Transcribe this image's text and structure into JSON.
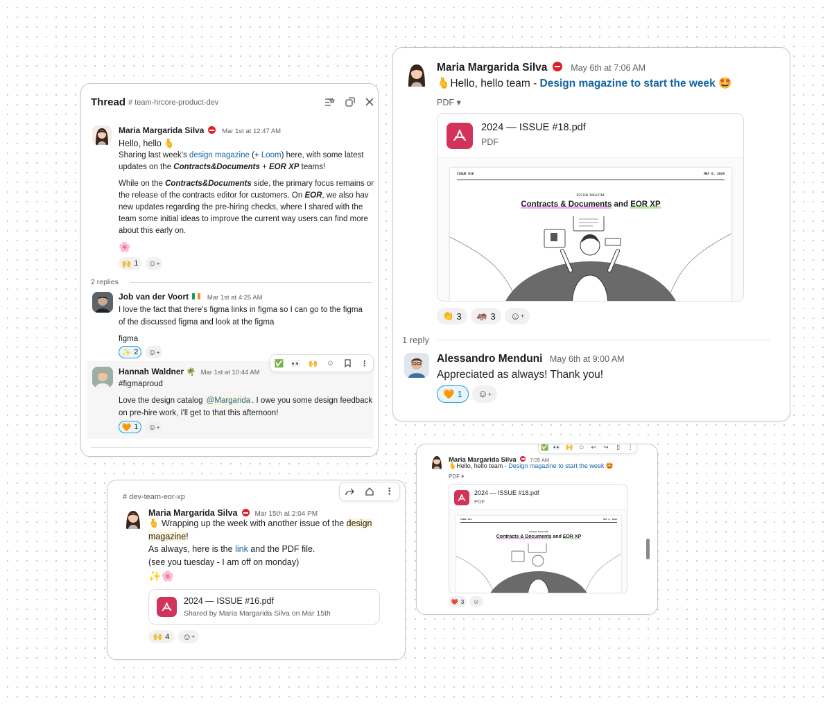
{
  "colors": {
    "link": "#1264a3",
    "pdf": "#d1335b",
    "mention_bg": "#fdf5d8",
    "reaction_active": "#1d9bd1"
  },
  "thread_panel": {
    "title": "Thread",
    "channel": "# team-hrcore-product-dev",
    "icons": [
      "list-settings-icon",
      "popout-icon",
      "close-icon"
    ],
    "parent": {
      "author": "Maria Margarida Silva",
      "status_icon": "no-entry-icon",
      "time": "Mar 1st at 12:47 AM",
      "line1": "Hello, hello",
      "line1_emoji": "🫰",
      "p1_a": "Sharing last week's ",
      "p1_link1": "design magazine",
      "p1_b": " (+ ",
      "p1_link2": "Loom",
      "p1_c": ") here, with some latest",
      "p1_d": "updates on the ",
      "p1_em1": "Contracts&Documents",
      "p1_e": " + ",
      "p1_em2": "EOR XP",
      "p1_f": " teams!",
      "p2_a": "While on the ",
      "p2_em1": "Contracts&Documents",
      "p2_b": " side, the primary focus remains on",
      "p2_c": "the release of the contracts editor for customers. On ",
      "p2_em2": "EOR",
      "p2_d": ", we also hav",
      "p2_e": "new updates regarding the pre-hiring checks, where I shared with the",
      "p2_f": "team some initial ideas to improve the current way users can find more",
      "p2_g": "about this early on.",
      "emoji_line": "🌸",
      "reaction": {
        "emoji": "🙌",
        "count": "1"
      }
    },
    "replies_label": "2 replies",
    "reply1": {
      "author": "Job van der Voort",
      "flag": "🇮🇪",
      "time": "Mar 1st at 4:25 AM",
      "line1": "I love the fact that there's figma links in figma so I can go to the figma",
      "line2": "of the discussed figma and look at the figma",
      "line3": "figma",
      "reaction": {
        "emoji": "✨",
        "count": "2"
      }
    },
    "reply2": {
      "author": "Hannah Waldner",
      "status": "🌴",
      "time": "Mar 1st at 10:44 AM",
      "line1": "#figmaproud",
      "line2_a": "Love the design catalog ",
      "line2_mention": "@Margarida",
      "line2_b": ". I owe you some design feedback",
      "line3": "on pre-hire work, I'll get to that this afternoon!",
      "reaction": {
        "emoji": "🧡",
        "count": "1"
      },
      "toolbar": [
        "✅",
        "👀",
        "🙌",
        "add-reaction-icon",
        "bookmark-icon",
        "more-icon"
      ]
    }
  },
  "main_panel": {
    "author": "Maria Margarida Silva",
    "time": "May 6th at 7:06 AM",
    "emoji": "🫰",
    "text_a": "Hello, hello team - ",
    "link": "Design magazine to start the week",
    "emoji_end": "🤩",
    "pdf_toggle": "PDF ▾",
    "file": {
      "name": "2024 — ISSUE #18.pdf",
      "type": "PDF"
    },
    "preview": {
      "issue": "ISSUE #18",
      "date": "MAY 6, 2024",
      "kicker": "DESIGN MAGAZINE",
      "title_a": "Contracts & Documents",
      "title_b": " and ",
      "title_c": "EOR XP"
    },
    "reactions": [
      {
        "emoji": "👏",
        "count": "3"
      },
      {
        "emoji": "🦛",
        "count": "3"
      }
    ],
    "reply_count": "1 reply",
    "reply": {
      "author": "Alessandro Menduni",
      "time": "May 6th at 9:00 AM",
      "text": "Appreciated as always! Thank you!",
      "reaction": {
        "emoji": "🧡",
        "count": "1"
      }
    }
  },
  "eor_panel": {
    "channel": "# dev-team-eor-xp",
    "author": "Maria Margarida Silva",
    "time": "Mar 15th at 2:04 PM",
    "toolbar": [
      "share-icon",
      "home-icon",
      "more-icon"
    ],
    "line1_emoji": "🫰",
    "line1_a": " Wrapping up the week with another issue of the ",
    "line1_hl": "design",
    "line2_hl": "magazine",
    "line2_b": "!",
    "line3_a": "As always, here is the ",
    "line3_link": "link",
    "line3_b": " and the PDF file.",
    "line4": "(see you tuesday - I am off on monday)",
    "emoji_line": "✨🌸",
    "file": {
      "name": "2024 — ISSUE #16.pdf",
      "shared": "Shared by Maria Margarida Silva on Mar 15th"
    },
    "reaction": {
      "emoji": "🙌",
      "count": "4"
    }
  },
  "small_panel": {
    "author": "Maria Margarida Silva",
    "time": "7:05 AM",
    "text_a": "Hello, hello team - ",
    "link": "Design magazine to start the week",
    "emoji": "🫰",
    "emoji_end": "🤩",
    "pdf_toggle": "PDF ▾",
    "file": {
      "name": "2024 — ISSUE #18.pdf",
      "type": "PDF"
    },
    "preview": {
      "issue": "ISSUE #18",
      "date": "MAY 6, 2024",
      "kicker": "DESIGN MAGAZINE",
      "title_a": "Contracts & Documents",
      "title_b": " and ",
      "title_c": "EOR XP"
    },
    "reaction": {
      "emoji": "❤️",
      "count": "3"
    }
  }
}
